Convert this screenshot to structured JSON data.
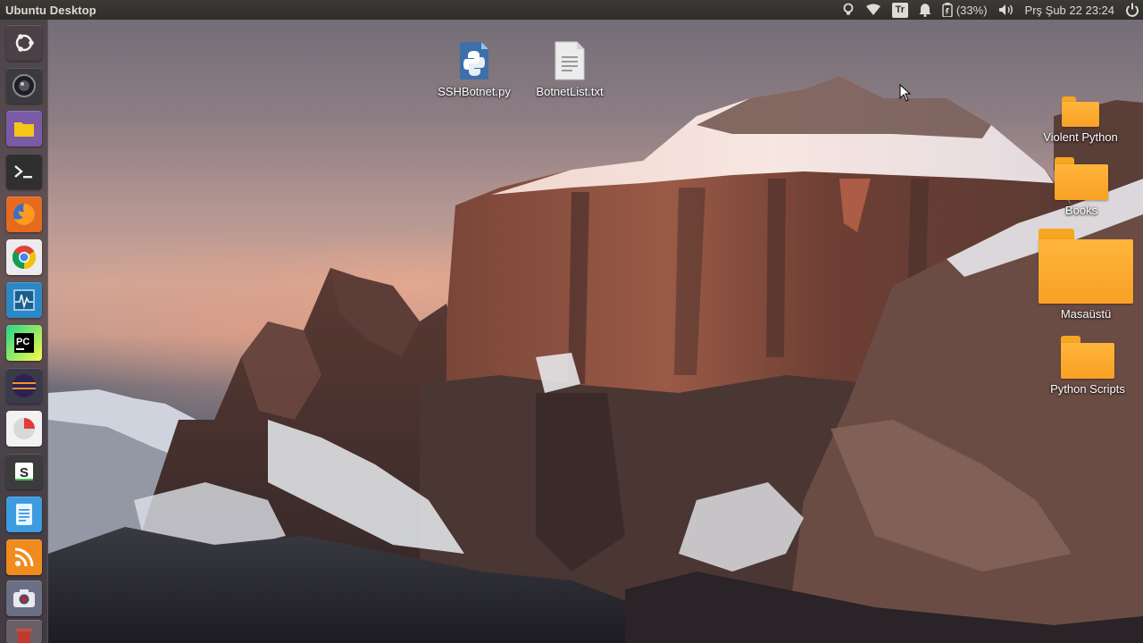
{
  "top_panel": {
    "title": "Ubuntu Desktop",
    "indicators": {
      "keyboard_layout": "Tr",
      "battery": "(33%)",
      "datetime": "Prş Şub 22 23:24"
    }
  },
  "launcher": {
    "items": [
      {
        "name": "ubuntu-dash",
        "icon": "ubuntu-logo-icon",
        "color": "#4a4046"
      },
      {
        "name": "camera-app",
        "icon": "webcam-icon",
        "color": "#3b3b3f"
      },
      {
        "name": "files",
        "icon": "folder-icon",
        "color": "#7b5aa6"
      },
      {
        "name": "terminal",
        "icon": "terminal-icon",
        "color": "#2f2f2f"
      },
      {
        "name": "firefox",
        "icon": "firefox-icon",
        "color": "#e66a1f"
      },
      {
        "name": "chrome",
        "icon": "chrome-icon",
        "color": "#ffffff"
      },
      {
        "name": "system-monitor",
        "icon": "system-monitor-icon",
        "color": "#2b87c5"
      },
      {
        "name": "pycharm",
        "icon": "pycharm-icon",
        "color": "#21d789"
      },
      {
        "name": "eclipse",
        "icon": "eclipse-icon",
        "color": "#2c2255"
      },
      {
        "name": "disk-usage",
        "icon": "pie-chart-icon",
        "color": "#f2f2f2"
      },
      {
        "name": "sublime",
        "icon": "sublime-s-icon",
        "color": "#3c3c3c"
      },
      {
        "name": "text-editor",
        "icon": "document-icon",
        "color": "#3d9be0"
      },
      {
        "name": "rss-reader",
        "icon": "rss-icon",
        "color": "#f08c1d"
      },
      {
        "name": "screenshot",
        "icon": "camera-icon",
        "color": "#6a6f83"
      },
      {
        "name": "trash",
        "icon": "trash-icon",
        "color": "#c0392b"
      }
    ]
  },
  "desktop": {
    "files": [
      {
        "label": "SSHBotnet.py",
        "icon": "python-file-icon",
        "color": "#3572a5"
      },
      {
        "label": "BotnetList.txt",
        "icon": "text-file-icon",
        "color": "#e6e6e6"
      }
    ],
    "folders": [
      {
        "label": "Violent Python",
        "icon": "folder-icon"
      },
      {
        "label": "Books",
        "icon": "folder-icon"
      },
      {
        "label": "Masaüstü",
        "icon": "folder-icon"
      },
      {
        "label": "Python Scripts",
        "icon": "folder-icon"
      }
    ],
    "folder_color": "#f7a125"
  }
}
